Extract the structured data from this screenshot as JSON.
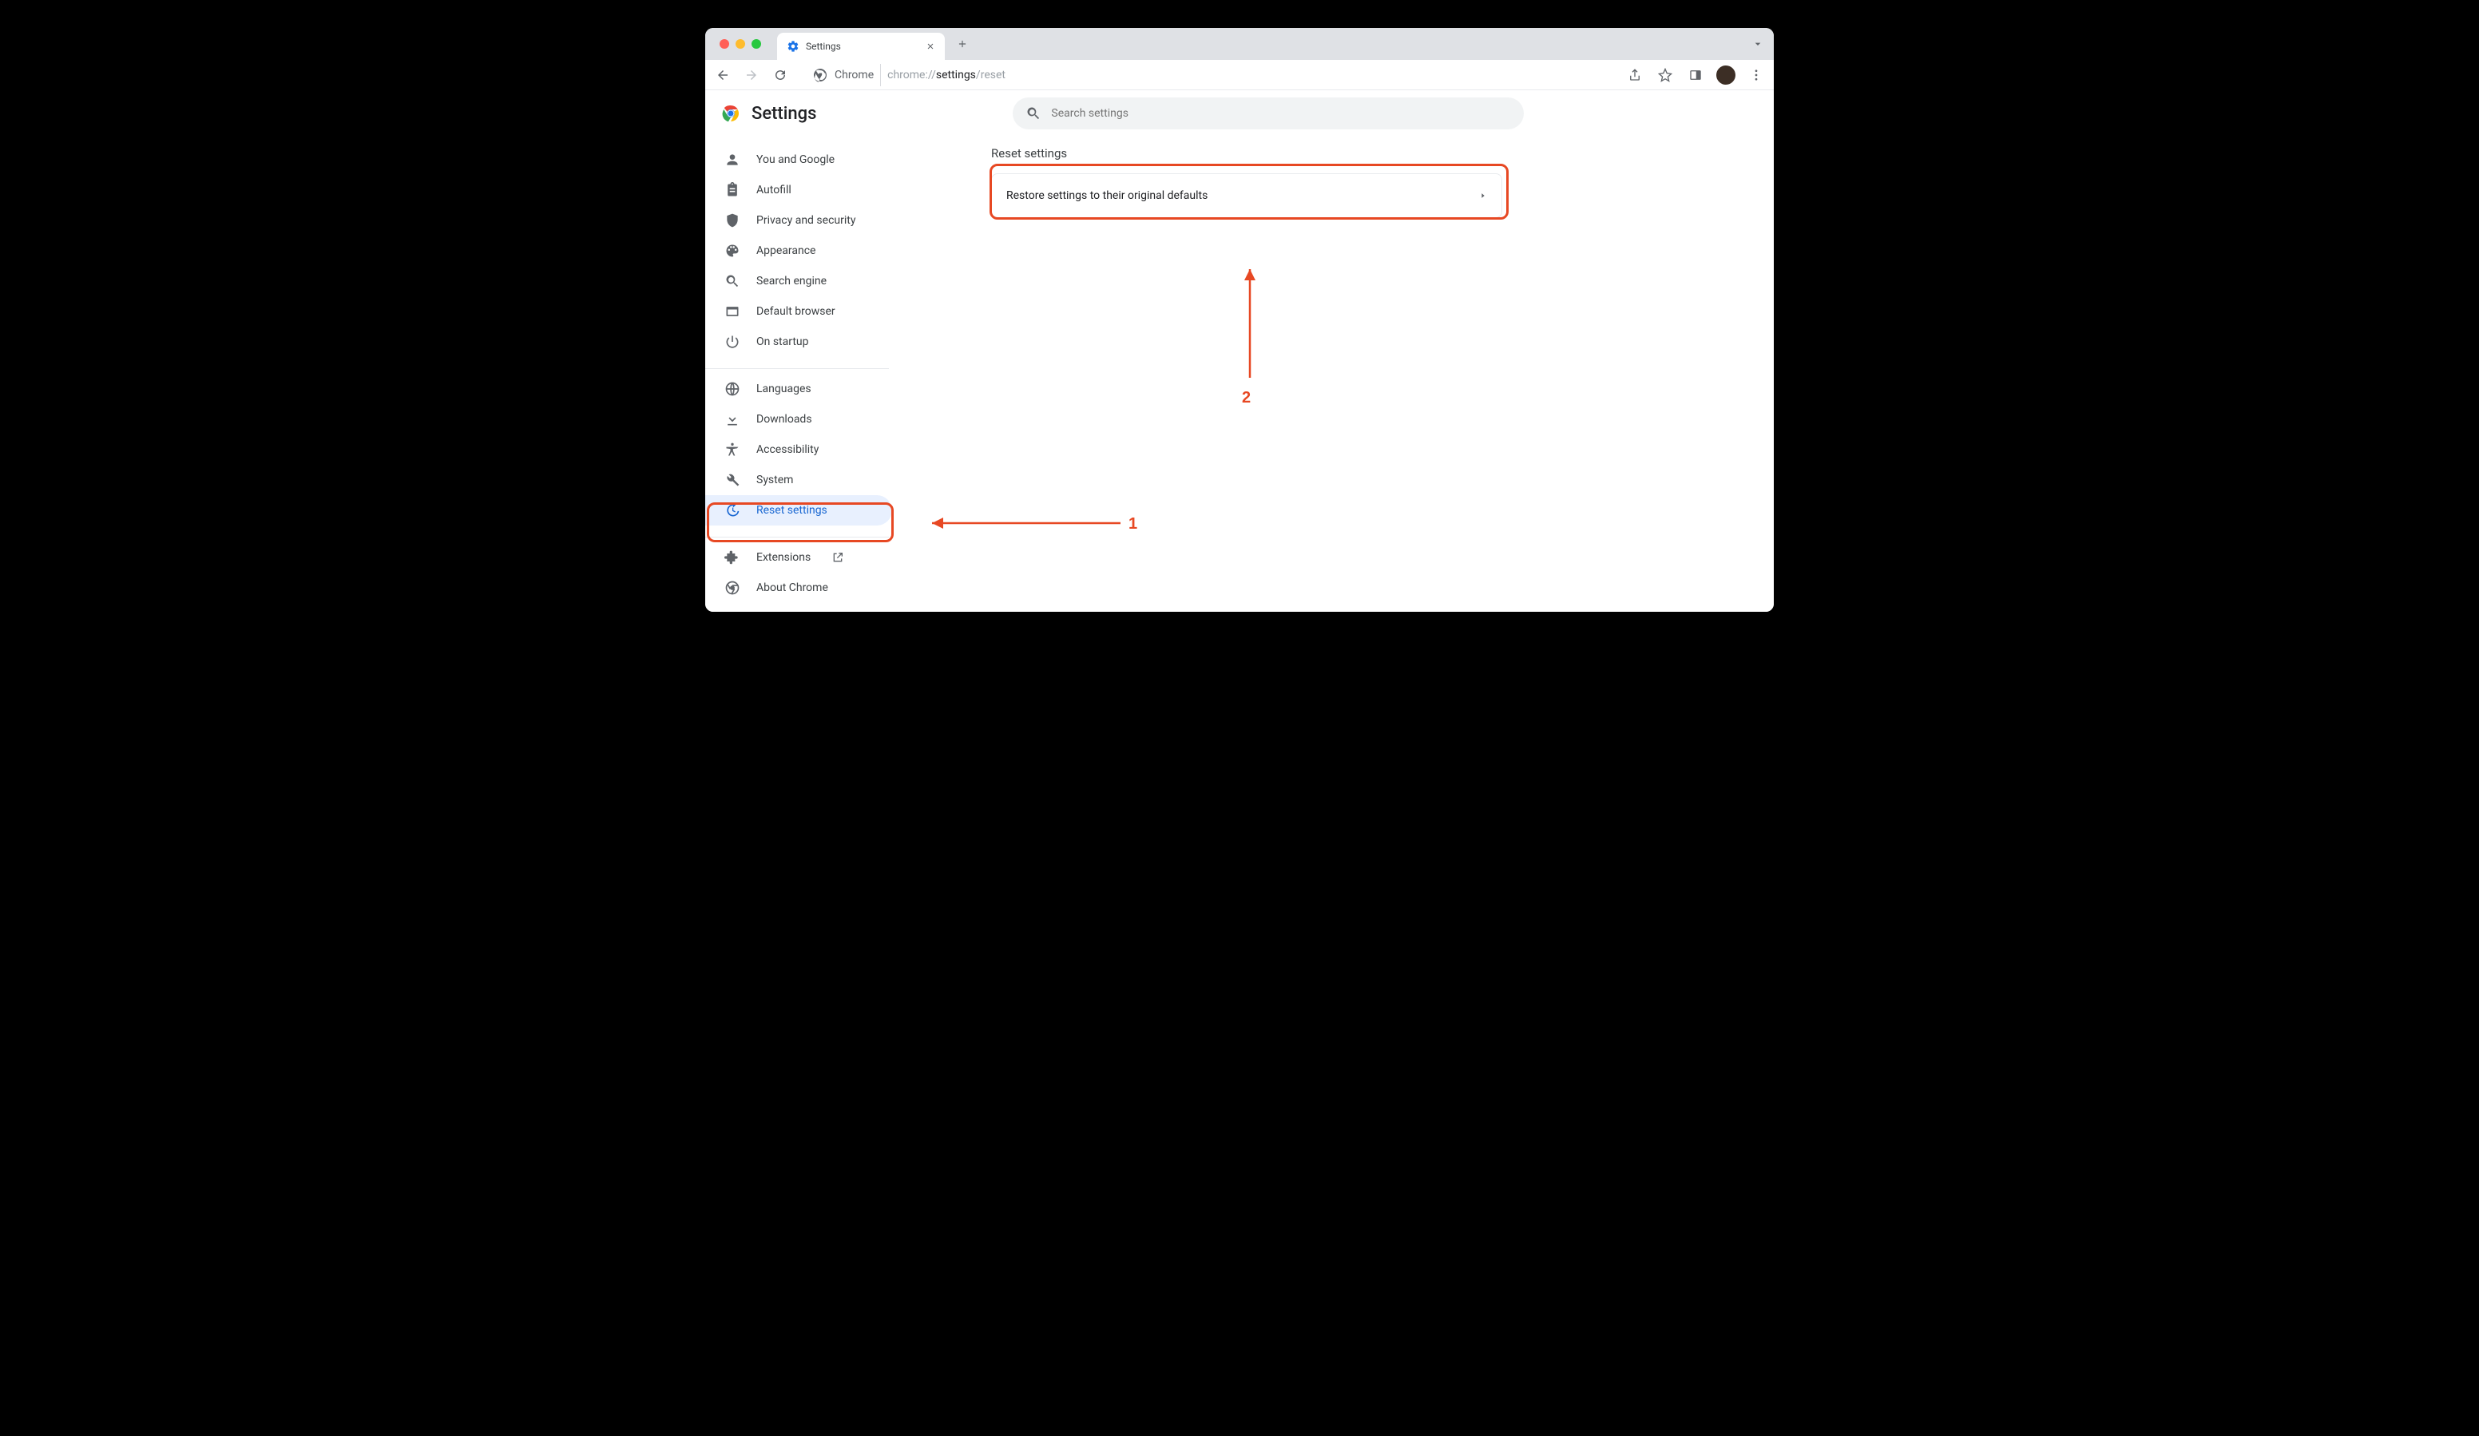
{
  "tab": {
    "title": "Settings"
  },
  "address": {
    "chip_label": "Chrome",
    "url_prefix": "chrome://",
    "url_bold": "settings",
    "url_suffix": "/reset"
  },
  "header": {
    "title": "Settings",
    "search_placeholder": "Search settings"
  },
  "sidebar": {
    "group1": [
      {
        "name": "you-and-google",
        "label": "You and Google"
      },
      {
        "name": "autofill",
        "label": "Autofill"
      },
      {
        "name": "privacy",
        "label": "Privacy and security"
      },
      {
        "name": "appearance",
        "label": "Appearance"
      },
      {
        "name": "search-engine",
        "label": "Search engine"
      },
      {
        "name": "default-browser",
        "label": "Default browser"
      },
      {
        "name": "on-startup",
        "label": "On startup"
      }
    ],
    "group2": [
      {
        "name": "languages",
        "label": "Languages"
      },
      {
        "name": "downloads",
        "label": "Downloads"
      },
      {
        "name": "accessibility",
        "label": "Accessibility"
      },
      {
        "name": "system",
        "label": "System"
      },
      {
        "name": "reset-settings",
        "label": "Reset settings",
        "active": true
      }
    ],
    "group3": [
      {
        "name": "extensions",
        "label": "Extensions",
        "external": true
      },
      {
        "name": "about-chrome",
        "label": "About Chrome"
      }
    ]
  },
  "main": {
    "section_title": "Reset settings",
    "card_label": "Restore settings to their original defaults"
  },
  "annotations": {
    "label1": "1",
    "label2": "2"
  }
}
